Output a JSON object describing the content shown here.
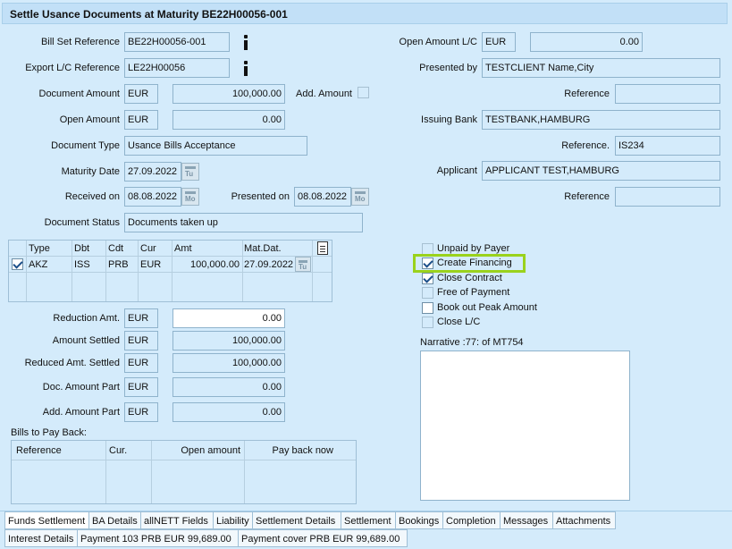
{
  "title": "Settle Usance Documents at Maturity BE22H00056-001",
  "left": {
    "bill_set_ref": {
      "label": "Bill Set Reference",
      "value": "BE22H00056-001"
    },
    "export_lc_ref": {
      "label": "Export L/C Reference",
      "value": "LE22H00056"
    },
    "doc_amount": {
      "label": "Document Amount",
      "currency": "EUR",
      "value": "100,000.00",
      "add_label": "Add. Amount"
    },
    "open_amount": {
      "label": "Open Amount",
      "currency": "EUR",
      "value": "0.00"
    },
    "doc_type": {
      "label": "Document Type",
      "value": "Usance Bills Acceptance"
    },
    "maturity_date": {
      "label": "Maturity Date",
      "value": "27.09.2022"
    },
    "received_on": {
      "label": "Received on",
      "value": "08.08.2022"
    },
    "presented_on": {
      "label": "Presented on",
      "value": "08.08.2022"
    },
    "doc_status": {
      "label": "Document Status",
      "value": "Documents taken up"
    }
  },
  "right": {
    "open_amount_lc": {
      "label": "Open Amount L/C",
      "currency": "EUR",
      "value": "0.00"
    },
    "presented_by": {
      "label": "Presented by",
      "value": "TESTCLIENT Name,City"
    },
    "reference1": {
      "label": "Reference",
      "value": ""
    },
    "issuing_bank": {
      "label": "Issuing Bank",
      "value": "TESTBANK,HAMBURG"
    },
    "reference2": {
      "label": "Reference.",
      "value": "IS234"
    },
    "applicant": {
      "label": "Applicant",
      "value": "APPLICANT TEST,HAMBURG"
    },
    "reference3": {
      "label": "Reference",
      "value": ""
    }
  },
  "acceptance_table": {
    "headers": [
      "Type",
      "Dbt",
      "Cdt",
      "Cur",
      "Amt",
      "Mat.Dat."
    ],
    "rows": [
      {
        "type": "AKZ",
        "dbt": "ISS",
        "cdt": "PRB",
        "cur": "EUR",
        "amt": "100,000.00",
        "mat": "27.09.2022",
        "checked": true
      }
    ]
  },
  "checkboxes": [
    {
      "label": "Unpaid by Payer",
      "checked": false,
      "disabled": true
    },
    {
      "label": "Create Financing",
      "checked": true,
      "highlighted": true
    },
    {
      "label": "Close Contract",
      "checked": true
    },
    {
      "label": "Free of Payment",
      "checked": false,
      "disabled": true
    },
    {
      "label": "Book out Peak Amount",
      "checked": false
    },
    {
      "label": "Close L/C",
      "checked": false,
      "disabled": true
    }
  ],
  "narrative": {
    "label": "Narrative :77: of MT754",
    "value": ""
  },
  "amounts": {
    "reduction_amt": {
      "label": "Reduction Amt.",
      "currency": "EUR",
      "value": "0.00"
    },
    "amount_settled": {
      "label": "Amount Settled",
      "currency": "EUR",
      "value": "100,000.00"
    },
    "reduced_amt_settled": {
      "label": "Reduced Amt. Settled",
      "currency": "EUR",
      "value": "100,000.00"
    },
    "doc_amount_part": {
      "label": "Doc. Amount Part",
      "currency": "EUR",
      "value": "0.00"
    },
    "add_amount_part": {
      "label": "Add. Amount Part",
      "currency": "EUR",
      "value": "0.00"
    }
  },
  "bills_to_pay_back": {
    "label": "Bills to Pay Back:",
    "headers": [
      "Reference",
      "Cur.",
      "Open amount",
      "Pay back now"
    ]
  },
  "tabs_row1": [
    "Funds Settlement",
    "BA Details",
    "allNETT Fields",
    "Liability",
    "Settlement Details",
    "Settlement",
    "Bookings",
    "Completion",
    "Messages",
    "Attachments"
  ],
  "tabs_row2": [
    "Interest Details",
    "Payment 103 PRB EUR 99,689.00",
    "Payment cover PRB EUR 99,689.00"
  ],
  "colors": {
    "background": "#d4ebfb",
    "highlight": "#9ad21c",
    "check": "#1b4f8a"
  }
}
